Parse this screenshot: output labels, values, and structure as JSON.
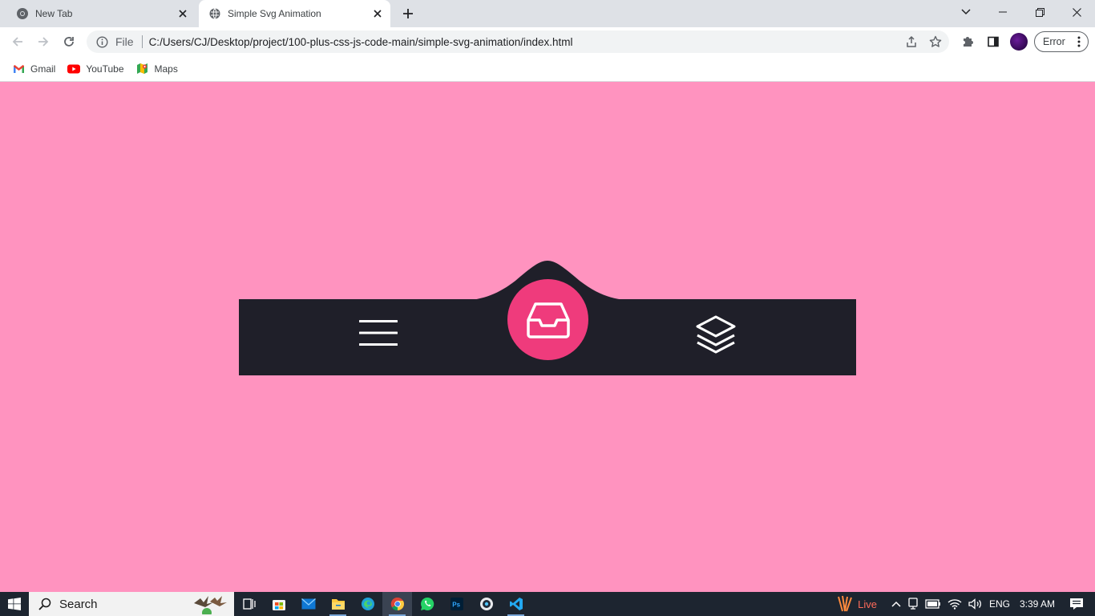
{
  "browser": {
    "tabs": [
      {
        "title": "New Tab",
        "active": false
      },
      {
        "title": "Simple Svg Animation",
        "active": true
      }
    ],
    "address": {
      "scheme_label": "File",
      "url": "C:/Users/CJ/Desktop/project/100-plus-css-js-code-main/simple-svg-animation/index.html"
    },
    "profile_error_label": "Error",
    "bookmarks": [
      {
        "label": "Gmail",
        "icon": "gmail-icon"
      },
      {
        "label": "YouTube",
        "icon": "youtube-icon"
      },
      {
        "label": "Maps",
        "icon": "maps-icon"
      }
    ]
  },
  "page": {
    "background_color": "#ff93bf",
    "nav_color": "#1f1f29",
    "accent_color": "#ef3b7c",
    "nav_items": [
      {
        "icon": "menu-icon",
        "active": false
      },
      {
        "icon": "inbox-icon",
        "active": true
      },
      {
        "icon": "layers-icon",
        "active": false
      }
    ]
  },
  "taskbar": {
    "search_label": "Search",
    "live_label": "Live",
    "language": "ENG",
    "time": "3:39 AM",
    "apps": [
      "task-view-icon",
      "store-icon",
      "mail-icon",
      "file-explorer-icon",
      "edge-icon",
      "chrome-icon",
      "whatsapp-icon",
      "photoshop-icon",
      "app-icon",
      "vscode-icon"
    ]
  }
}
